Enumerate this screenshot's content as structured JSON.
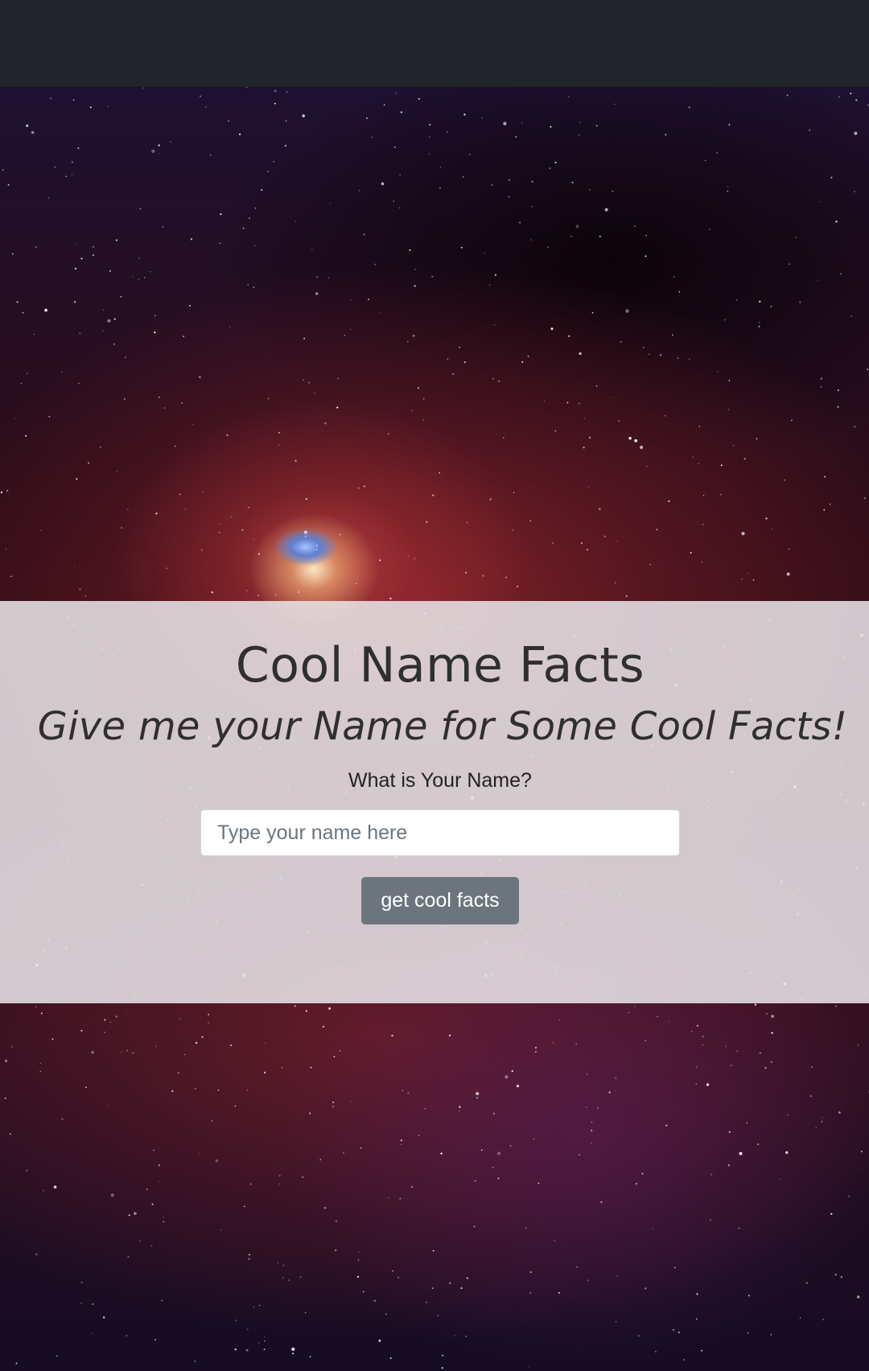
{
  "hero": {
    "title": "Cool Name Facts",
    "subtitle": "Give me your Name for Some Cool Facts!",
    "form": {
      "label": "What is Your Name?",
      "input_placeholder": "Type your name here",
      "input_value": "",
      "submit_label": "get cool facts"
    }
  },
  "colors": {
    "navbar": "#212529",
    "panel": "#e6e2e6",
    "button": "#6c757d",
    "text": "#2f2f2f"
  }
}
